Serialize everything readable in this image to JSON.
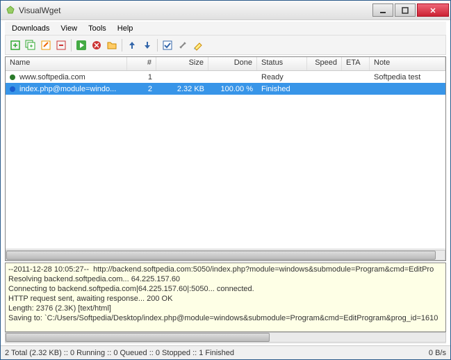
{
  "window": {
    "title": "VisualWget"
  },
  "menu": {
    "downloads": "Downloads",
    "view": "View",
    "tools": "Tools",
    "help": "Help"
  },
  "columns": {
    "name": "Name",
    "num": "#",
    "size": "Size",
    "done": "Done",
    "status": "Status",
    "speed": "Speed",
    "eta": "ETA",
    "note": "Note"
  },
  "rows": [
    {
      "name": "www.softpedia.com",
      "num": "1",
      "size": "",
      "done": "",
      "status": "Ready",
      "speed": "",
      "eta": "",
      "note": "Softpedia test",
      "selected": false,
      "icon_color": "#2a7a2a"
    },
    {
      "name": "index.php@module=windo...",
      "num": "2",
      "size": "2.32 KB",
      "done": "100.00 %",
      "status": "Finished",
      "speed": "",
      "eta": "",
      "note": "",
      "selected": true,
      "icon_color": "#1a5fd0"
    }
  ],
  "log": "--2011-12-28 10:05:27--  http://backend.softpedia.com:5050/index.php?module=windows&submodule=Program&cmd=EditPro\nResolving backend.softpedia.com... 64.225.157.60\nConnecting to backend.softpedia.com|64.225.157.60|:5050... connected.\nHTTP request sent, awaiting response... 200 OK\nLength: 2376 (2.3K) [text/html]\nSaving to: `C:/Users/Softpedia/Desktop/index.php@module=windows&submodule=Program&cmd=EditProgram&prog_id=1610",
  "status": {
    "left": "2 Total (2.32 KB) :: 0 Running :: 0 Queued :: 0 Stopped :: 1 Finished",
    "right": "0 B/s"
  }
}
